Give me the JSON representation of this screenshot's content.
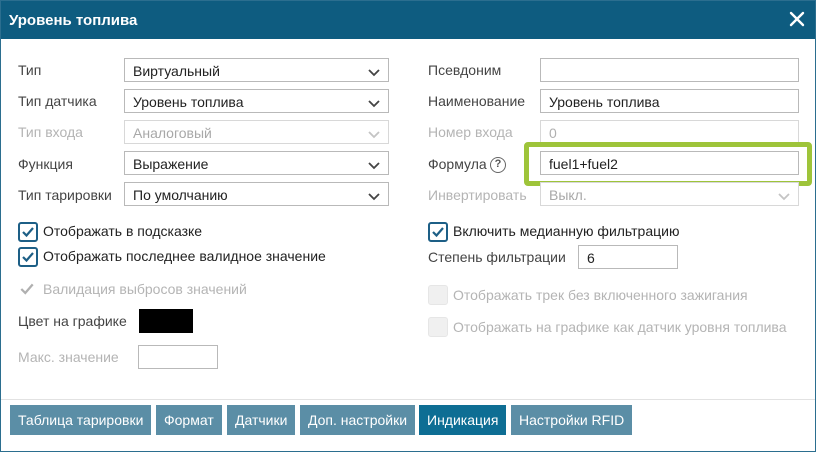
{
  "dialog": {
    "title": "Уровень топлива"
  },
  "left": {
    "type": {
      "label": "Тип",
      "value": "Виртуальный"
    },
    "sensor_type": {
      "label": "Тип датчика",
      "value": "Уровень топлива"
    },
    "input_type": {
      "label": "Тип входа",
      "value": "Аналоговый"
    },
    "function": {
      "label": "Функция",
      "value": "Выражение"
    },
    "calibration_type": {
      "label": "Тип тарировки",
      "value": "По умолчанию"
    },
    "show_in_tooltip": {
      "label": "Отображать в подсказке",
      "checked": true
    },
    "show_last_valid": {
      "label": "Отображать последнее валидное значение",
      "checked": true
    },
    "outlier_validation": {
      "label": "Валидация выбросов значений",
      "checked": true
    },
    "chart_color": {
      "label": "Цвет на графике",
      "color": "#000000"
    },
    "max_value": {
      "label": "Макс. значение",
      "value": ""
    }
  },
  "right": {
    "alias": {
      "label": "Псевдоним",
      "value": ""
    },
    "name": {
      "label": "Наименование",
      "value": "Уровень топлива"
    },
    "input_number": {
      "label": "Номер входа",
      "value": "0"
    },
    "formula": {
      "label": "Формула",
      "value": "fuel1+fuel2"
    },
    "invert": {
      "label": "Инвертировать",
      "value": "Выкл."
    },
    "median_filter": {
      "label": "Включить медианную фильтрацию",
      "checked": true
    },
    "filter_degree": {
      "label": "Степень фильтрации",
      "value": "6"
    },
    "track_without_ignition": {
      "label": "Отображать трек без включенного зажигания",
      "checked": false
    },
    "show_as_fuel_sensor": {
      "label": "Отображать на графике как датчик уровня топлива",
      "checked": false
    }
  },
  "tabs": [
    {
      "label": "Таблица тарировки",
      "active": false
    },
    {
      "label": "Формат",
      "active": false
    },
    {
      "label": "Датчики",
      "active": false
    },
    {
      "label": "Доп. настройки",
      "active": false
    },
    {
      "label": "Индикация",
      "active": true
    },
    {
      "label": "Настройки RFID",
      "active": false
    }
  ],
  "colors": {
    "titlebar": "#0e5c80",
    "accent": "#1d5f86",
    "highlight": "#9ec43a",
    "tab": "#5b8ea6",
    "tab_active": "#0e6e94"
  }
}
